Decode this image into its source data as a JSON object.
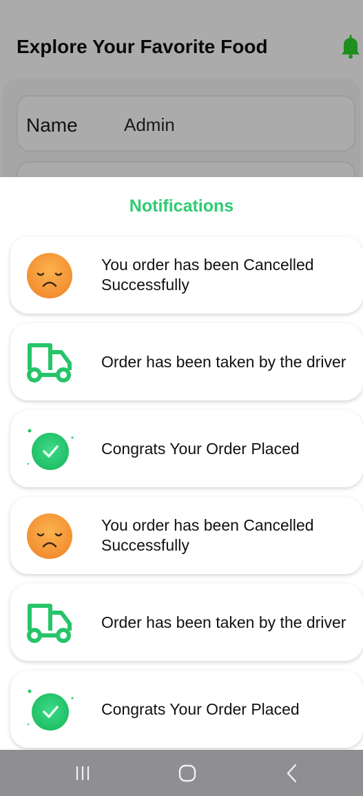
{
  "background": {
    "title": "Explore Your Favorite Food",
    "fields": [
      {
        "label": "Name",
        "value": "Admin"
      }
    ]
  },
  "notifications_panel": {
    "title": "Notifications",
    "items": [
      {
        "icon": "sad-face-icon",
        "text": "You order has been Cancelled Successfully"
      },
      {
        "icon": "delivery-truck-icon",
        "text": "Order has been taken by the driver"
      },
      {
        "icon": "success-check-icon",
        "text": "Congrats Your Order Placed"
      },
      {
        "icon": "sad-face-icon",
        "text": "You order has been Cancelled Successfully"
      },
      {
        "icon": "delivery-truck-icon",
        "text": "Order has been taken by the driver"
      },
      {
        "icon": "success-check-icon",
        "text": "Congrats Your Order Placed"
      }
    ]
  },
  "colors": {
    "accent_green": "#2ecc71",
    "bell_green": "#1e8e1e",
    "sad_face_orange": "#f7a13a",
    "overlay_gray": "#ababab",
    "navbar_gray": "#8e8e93"
  },
  "navbar": {
    "buttons": [
      "recent-apps-icon",
      "home-icon",
      "back-icon"
    ]
  }
}
